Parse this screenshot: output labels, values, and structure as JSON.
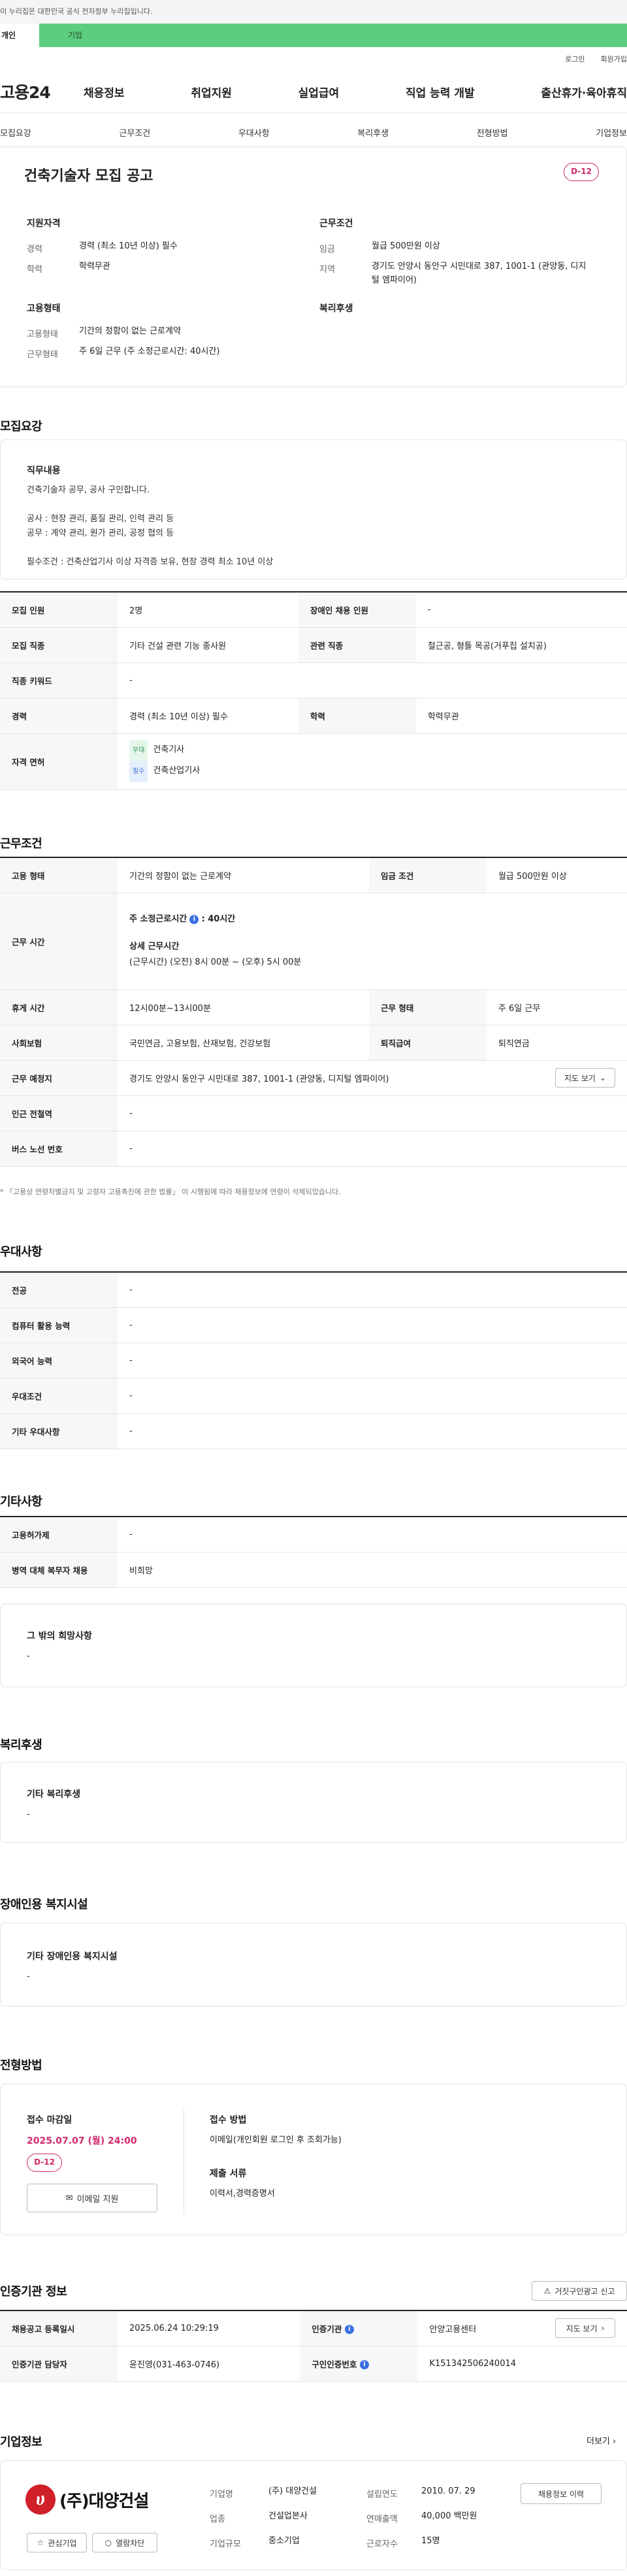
{
  "gov_bar": "이 누리집은 대한민국 공식 전자정부 누리집입니다.",
  "user_tabs": [
    "개인",
    "기업"
  ],
  "util": {
    "login": "로그인",
    "signup": "회원가입"
  },
  "logo": "고용24",
  "gnb": [
    "채용정보",
    "취업지원",
    "실업급여",
    "직업 능력 개발",
    "출산휴가·육아휴직"
  ],
  "subtabs": [
    "모집요강",
    "근무조건",
    "우대사항",
    "복리후생",
    "전형방법",
    "기업정보"
  ],
  "summary": {
    "title": "건축기술자 모집 공고",
    "dday": "D-12",
    "qual_title": "지원자격",
    "career_label": "경력",
    "career_value": "경력 (최소 10년 이상) 필수",
    "edu_label": "학력",
    "edu_value": "학력무관",
    "cond_title": "근무조건",
    "wage_label": "임금",
    "wage_value": "월급 500만원 이상",
    "area_label": "지역",
    "area_value": "경기도 안양시 동안구 시민대로 387, 1001-1 (관양동, 디지털 엠파이어)",
    "emp_title": "고용형태",
    "emptype_label": "고용형태",
    "emptype_value": "기간의 정함이 없는 근로계약",
    "worktype_label": "근무형태",
    "worktype_value": "주 6일 근무 (주 소정근로시간: 40시간)",
    "welfare_title": "복리후생"
  },
  "recruit": {
    "title": "모집요강",
    "duty_title": "직무내용",
    "duty_lines": [
      "건축기술자 공무, 공사 구인합니다.",
      "",
      "공사 : 현장 관리, 품질 관리, 인력 관리 등",
      "공무 : 계약 관리, 원가 관리, 공정 협의 등",
      "",
      "필수조건 : 건축산업기사 이상 자격증 보유, 현장 경력 최소 10년 이상"
    ],
    "rows": {
      "headcount_label": "모집 인원",
      "headcount": "2명",
      "disabled_label": "장애인 채용 인원",
      "disabled": "-",
      "job_label": "모집 직종",
      "job": "기타 건설 관련 기능 종사원",
      "related_label": "관련 직종",
      "related": "철근공, 형틀 목공(거푸집 설치공)",
      "keyword_label": "직종 키워드",
      "keyword": "-",
      "career_label": "경력",
      "career": "경력 (최소 10년 이상) 필수",
      "edu_label": "학력",
      "edu": "학력무관",
      "license_label": "자격 면허",
      "license_tag1": "우대",
      "license1": "건축기사",
      "license_tag2": "필수",
      "license2": "건축산업기사"
    }
  },
  "work": {
    "title": "근무조건",
    "emptype_label": "고용 형태",
    "emptype": "기간의 정함이 없는 근로계약",
    "wage_label": "임금 조건",
    "wage": "월급 500만원 이상",
    "hours_label": "근무 시간",
    "hours_main_prefix": "주 소정근로시간",
    "hours_main_value": ": 40시간",
    "hours_detail_title": "상세 근무시간",
    "hours_detail": "(근무시간) (오전) 8시 00분 ~ (오후) 5시 00분",
    "rest_label": "휴게 시간",
    "rest": "12시00분~13시00분",
    "form_label": "근무 형태",
    "form": "주 6일 근무",
    "insurance_label": "사회보험",
    "insurance": "국민연금, 고용보험, 산재보험, 건강보험",
    "retire_label": "퇴직급여",
    "retire": "퇴직연금",
    "place_label": "근무 예정지",
    "place": "경기도 안양시 동안구 시민대로 387, 1001-1 (관양동, 디지털 엠파이어)",
    "map_btn": "지도 보기",
    "subway_label": "인근 전철역",
    "subway": "-",
    "bus_label": "버스 노선 번호",
    "bus": "-",
    "note": "* 「고용상 연령차별금지 및 고령자 고용촉진에 관한 법률」 이 시행됨에 따라 채용정보에 연령이 삭제되었습니다."
  },
  "pref": {
    "title": "우대사항",
    "major_label": "전공",
    "major": "-",
    "pc_label": "컴퓨터 활용 능력",
    "pc": "-",
    "lang_label": "외국어 능력",
    "lang": "-",
    "cond_label": "우대조건",
    "cond": "-",
    "etc_label": "기타 우대사항",
    "etc": "-"
  },
  "other": {
    "title": "기타사항",
    "support_label": "고용허가제",
    "support": "-",
    "military_label": "병역 대체 복무자 채용",
    "military": "비희망",
    "wish_title": "그 밖의 희망사항",
    "wish": "-"
  },
  "welfare": {
    "title": "복리후생",
    "sub": "기타 복리후생",
    "value": "-"
  },
  "facility": {
    "title": "장애인용 복지시설",
    "sub": "기타 장애인용 복지시설",
    "value": "-"
  },
  "selection": {
    "title": "전형방법",
    "deadline_title": "접수 마감일",
    "deadline": "2025.07.07 (월) 24:00",
    "dday": "D-12",
    "email_btn": "이메일 지원",
    "method_title": "접수 방법",
    "method": "이메일(개인회원 로그인 후 조회가능)",
    "docs_title": "제출 서류",
    "docs": "이력서,경력증명서"
  },
  "cert": {
    "title": "인증기관 정보",
    "report_btn": "거짓구인광고 신고",
    "reg_label": "채용공고 등록일시",
    "reg": "2025.06.24 10:29:19",
    "org_label": "인증기관",
    "org": "안양고용센터",
    "map_btn": "지도 보기",
    "manager_label": "인증기관 담당자",
    "manager": "윤진영(031-463-0746)",
    "num_label": "구인인증번호",
    "num": "K151342506240014"
  },
  "company": {
    "title": "기업정보",
    "more": "더보기",
    "logo_text": "(주)대양건설",
    "fav_btn": "관심기업",
    "block_btn": "열람차단",
    "history_btn": "채용정보 이력",
    "name_label": "기업명",
    "name": "(주) 대양건설",
    "est_label": "설립연도",
    "est": "2010. 07. 29",
    "biz_label": "업종",
    "biz": "건설업본사",
    "sales_label": "연매출액",
    "sales": "40,000 백만원",
    "size_label": "기업규모",
    "size": "중소기업",
    "emp_label": "근로자수",
    "emp": "15명"
  },
  "colors": {
    "accent_green": "#5ccd7e",
    "dday_pink": "#d12a6b",
    "info_blue": "#3b6fe0"
  }
}
